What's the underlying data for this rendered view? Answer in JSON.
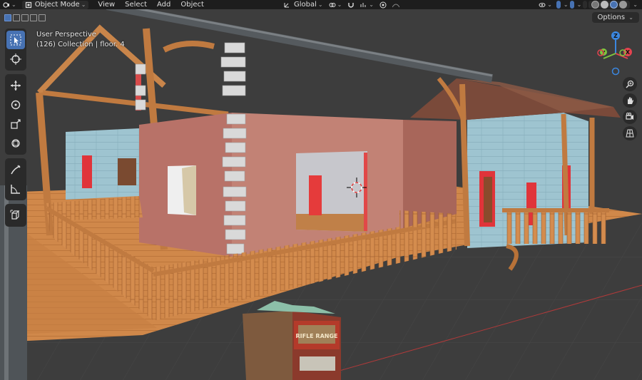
{
  "header": {
    "mode_label": "Object Mode",
    "menus": [
      "View",
      "Select",
      "Add",
      "Object"
    ],
    "transform_orientation": "Global"
  },
  "row2": {
    "options_label": "Options"
  },
  "viewport": {
    "perspective_label": "User Perspective",
    "collection_label": "(126) Collection | floor. 4"
  },
  "scene": {
    "sign_text_1": "RIFLE RANGE"
  },
  "gizmo": {
    "x_label": "X",
    "y_label": "Y",
    "z_label": "Z"
  },
  "colors": {
    "accent": "#4772b3",
    "header_bg": "#1d1d1d",
    "viewport_bg": "#3d3d3d",
    "axis_x": "#e4434f",
    "axis_y": "#7ec53f",
    "axis_z": "#3b87e0"
  }
}
